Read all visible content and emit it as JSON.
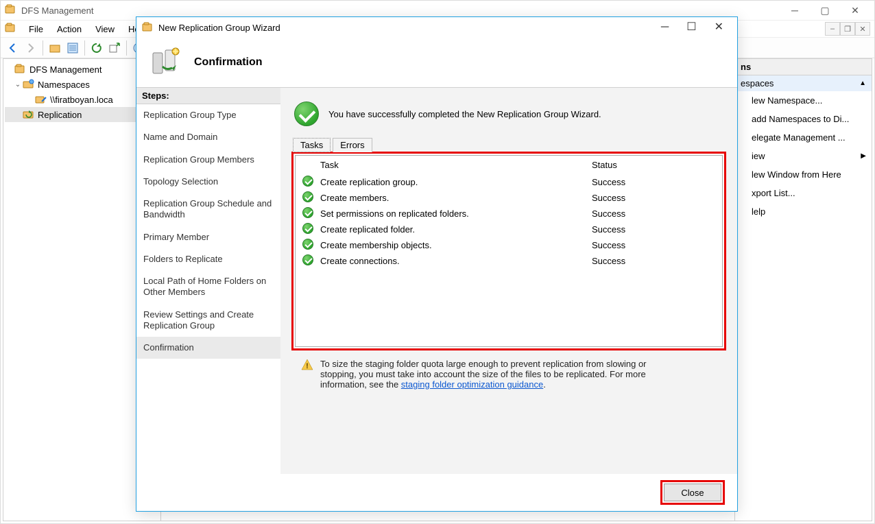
{
  "mmc": {
    "title": "DFS Management",
    "menubar": {
      "file": "File",
      "action": "Action",
      "view": "View",
      "help": "Help"
    },
    "toolbar_icons": [
      "back",
      "forward",
      "up",
      "props",
      "refresh",
      "export",
      "help"
    ],
    "tree": [
      {
        "level": 1,
        "exp": "",
        "icon": "dfs",
        "label": "DFS Management"
      },
      {
        "level": 2,
        "exp": "v",
        "icon": "namespace",
        "label": "Namespaces"
      },
      {
        "level": 3,
        "exp": "",
        "icon": "ns-link",
        "label": "\\\\firatboyan.loca"
      },
      {
        "level": 2,
        "exp": "",
        "icon": "replication",
        "label": "Replication",
        "selected": true
      }
    ],
    "actions": {
      "header": "ns",
      "group_label": "espaces",
      "items": [
        {
          "label": "lew Namespace..."
        },
        {
          "label": "add Namespaces to Di..."
        },
        {
          "label": "elegate Management ..."
        },
        {
          "label": "iew",
          "has_arrow": true
        },
        {
          "label": "lew Window from Here"
        },
        {
          "label": "xport List..."
        },
        {
          "label": "lelp"
        }
      ]
    }
  },
  "wizard": {
    "title": "New Replication Group Wizard",
    "header": "Confirmation",
    "steps_header": "Steps:",
    "steps": [
      "Replication Group Type",
      "Name and Domain",
      "Replication Group Members",
      "Topology Selection",
      "Replication Group Schedule and Bandwidth",
      "Primary Member",
      "Folders to Replicate",
      "Local Path of Home Folders on Other Members",
      "Review Settings and Create Replication Group",
      "Confirmation"
    ],
    "success_msg": "You have successfully completed the New Replication Group Wizard.",
    "tabs": {
      "tasks": "Tasks",
      "errors": "Errors"
    },
    "task_headers": {
      "task": "Task",
      "status": "Status"
    },
    "tasks": [
      {
        "task": "Create replication group.",
        "status": "Success"
      },
      {
        "task": "Create members.",
        "status": "Success"
      },
      {
        "task": "Set permissions on replicated folders.",
        "status": "Success"
      },
      {
        "task": "Create replicated folder.",
        "status": "Success"
      },
      {
        "task": "Create membership objects.",
        "status": "Success"
      },
      {
        "task": "Create connections.",
        "status": "Success"
      }
    ],
    "hint_text": "To size the staging folder quota large enough to prevent replication from slowing or stopping, you must take into account the size of the files to be replicated. For more information, see the ",
    "hint_link": "staging folder optimization guidance",
    "hint_period": ".",
    "close_label": "Close"
  }
}
